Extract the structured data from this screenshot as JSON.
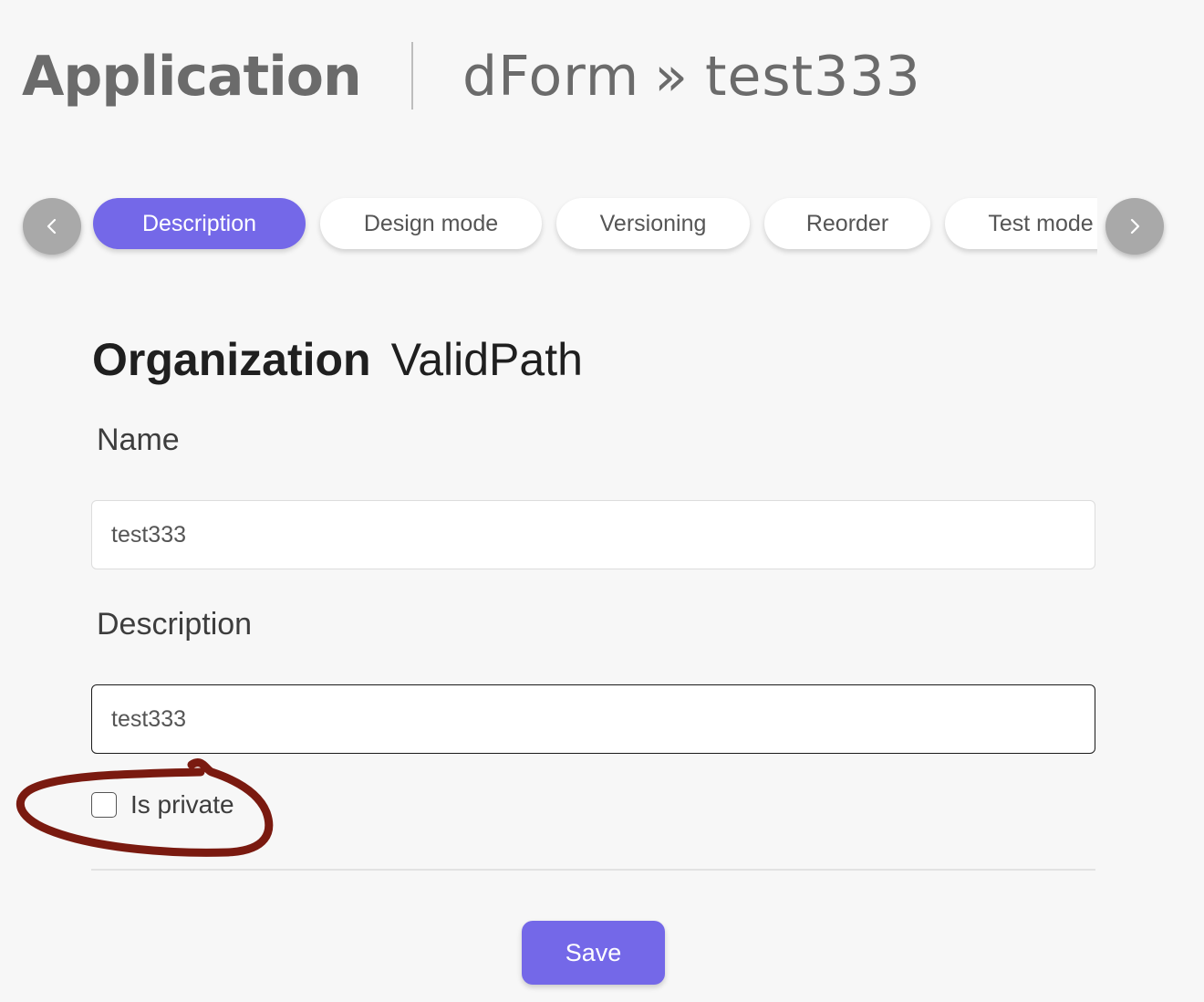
{
  "header": {
    "title": "Application",
    "breadcrumb": {
      "parent": "dForm",
      "separator": "»",
      "current": "test333"
    }
  },
  "tabs": {
    "items": [
      {
        "label": "Description",
        "active": true
      },
      {
        "label": "Design mode",
        "active": false
      },
      {
        "label": "Versioning",
        "active": false
      },
      {
        "label": "Reorder",
        "active": false
      },
      {
        "label": "Test mode",
        "active": false
      }
    ],
    "prev_icon": "chevron-left-icon",
    "next_icon": "chevron-right-icon"
  },
  "form": {
    "organization_label": "Organization",
    "organization_value": "ValidPath",
    "name_label": "Name",
    "name_value": "test333",
    "description_label": "Description",
    "description_value": "test333",
    "is_private_label": "Is private",
    "is_private_checked": false,
    "save_label": "Save"
  },
  "colors": {
    "accent": "#7468e8",
    "annotation": "#7a1a10",
    "background": "#f7f7f7"
  }
}
